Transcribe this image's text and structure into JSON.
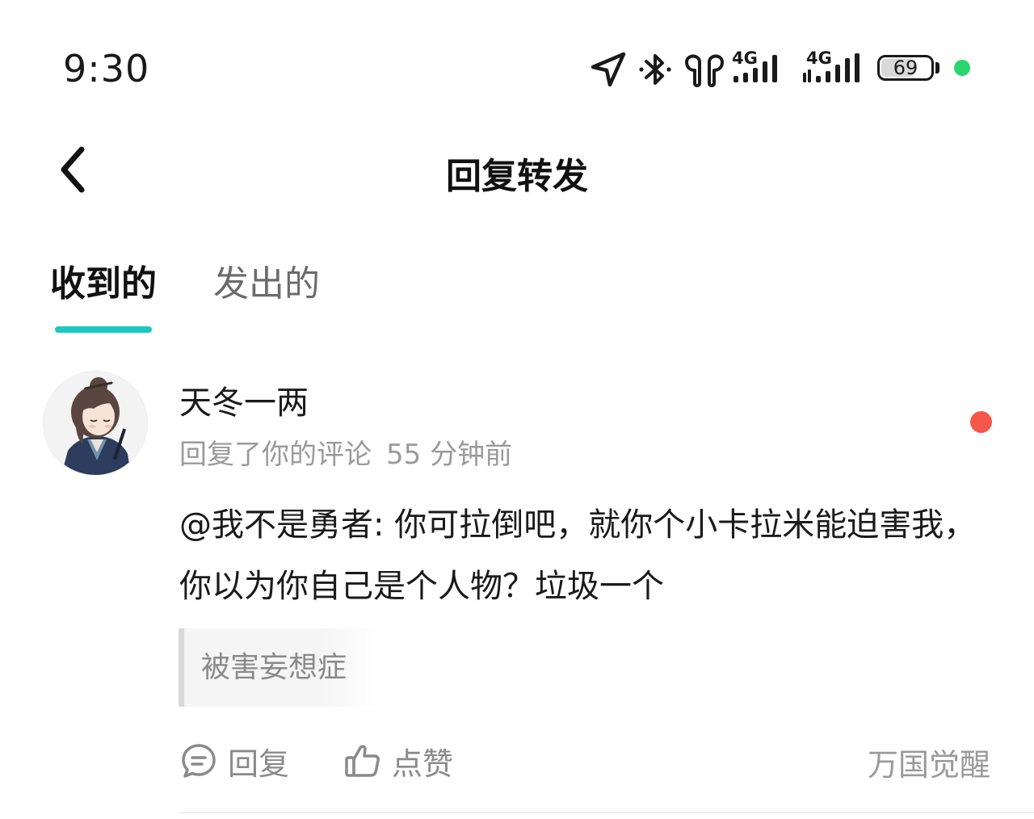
{
  "status_bar": {
    "time": "9:30",
    "network_1": "4G",
    "network_2": "4G",
    "battery_level": 69,
    "battery_text": "69",
    "privacy_indicator_color": "#2dd36f"
  },
  "header": {
    "title": "回复转发"
  },
  "tabs": [
    {
      "label": "收到的",
      "active": true
    },
    {
      "label": "发出的",
      "active": false
    }
  ],
  "accent_color": "#1fc7c0",
  "reply": {
    "username": "天冬一两",
    "action_text": "回复了你的评论",
    "time_ago": "55 分钟前",
    "content": "@我不是勇者: 你可拉倒吧，就你个小卡拉米能迫害我，你以为你自己是个人物？垃圾一个",
    "quoted_comment": "被害妄想症",
    "unread_dot_color": "#f5574a",
    "actions": {
      "reply_label": "回复",
      "like_label": "点赞"
    },
    "source": "万国觉醒"
  }
}
